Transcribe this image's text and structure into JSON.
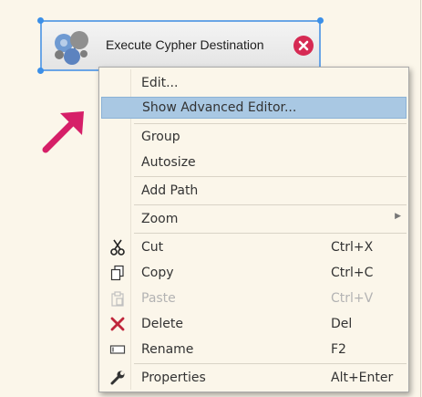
{
  "node": {
    "title": "Execute Cypher Destination",
    "icon": "graph-db-icon",
    "close_icon": "close-icon"
  },
  "colors": {
    "accent_arrow": "#d61f68",
    "highlight": "#a9c8e3",
    "selection_border": "#3b8fe8",
    "delete_red": "#c0263b"
  },
  "menu": {
    "items": [
      {
        "label": "Edit..."
      },
      {
        "label": "Show Advanced Editor..."
      },
      {
        "label": "Group"
      },
      {
        "label": "Autosize"
      },
      {
        "label": "Add Path"
      },
      {
        "label": "Zoom"
      },
      {
        "label": "Cut",
        "shortcut": "Ctrl+X",
        "icon": "scissors-icon"
      },
      {
        "label": "Copy",
        "shortcut": "Ctrl+C",
        "icon": "copy-icon"
      },
      {
        "label": "Paste",
        "shortcut": "Ctrl+V",
        "icon": "paste-icon",
        "disabled": true
      },
      {
        "label": "Delete",
        "shortcut": "Del",
        "icon": "delete-icon"
      },
      {
        "label": "Rename",
        "shortcut": "F2",
        "icon": "rename-icon"
      },
      {
        "label": "Properties",
        "shortcut": "Alt+Enter",
        "icon": "wrench-icon"
      }
    ]
  }
}
